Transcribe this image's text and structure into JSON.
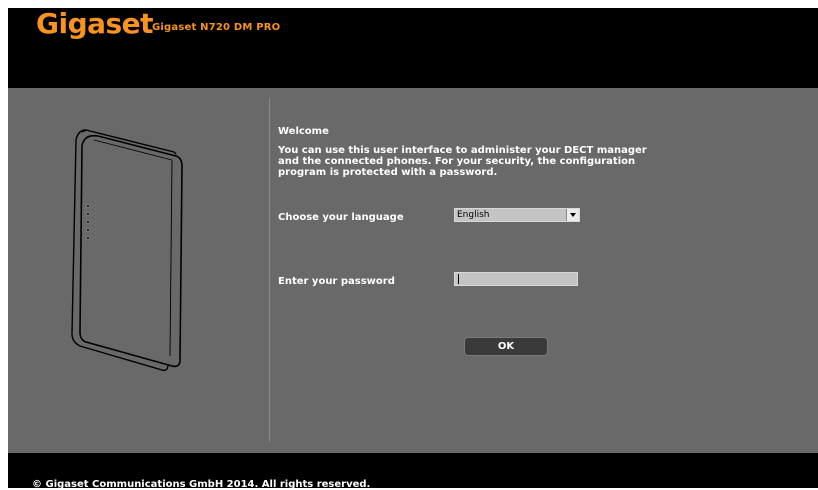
{
  "header": {
    "logo": "Gigaset",
    "model": "Gigaset N720 DM PRO"
  },
  "welcome": {
    "title": "Welcome",
    "text": "You can use this user interface to administer your DECT manager and the connected phones. For your security, the configuration program is protected with a password."
  },
  "language": {
    "label": "Choose your language",
    "selected": "English"
  },
  "password": {
    "label": "Enter your password",
    "value": ""
  },
  "ok_label": "OK",
  "footer": {
    "copyright": "© Gigaset Communications GmbH 2014. All rights reserved."
  },
  "colors": {
    "brand": "#f7931e",
    "panel": "#696969"
  }
}
